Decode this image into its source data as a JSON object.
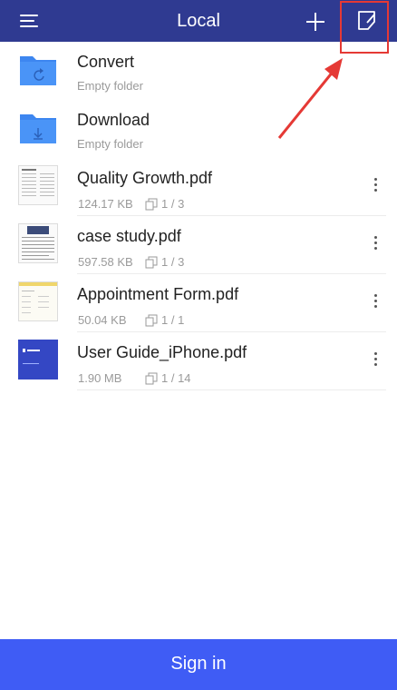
{
  "header": {
    "title": "Local",
    "menu_icon": "hamburger-menu-icon",
    "add_icon": "plus-icon",
    "edit_icon": "edit-note-icon",
    "bar_color": "#2f3a91"
  },
  "annotation": {
    "color": "#e53935"
  },
  "folders": [
    {
      "name": "Convert",
      "subtitle": "Empty folder",
      "icon": "folder-sync-icon"
    },
    {
      "name": "Download",
      "subtitle": "Empty folder",
      "icon": "folder-download-icon"
    }
  ],
  "files": [
    {
      "name": "Quality Growth.pdf",
      "size": "124.17 KB",
      "pages": "1 / 3"
    },
    {
      "name": "case study.pdf",
      "size": "597.58 KB",
      "pages": "1 / 3"
    },
    {
      "name": "Appointment Form.pdf",
      "size": "50.04 KB",
      "pages": "1 / 1"
    },
    {
      "name": "User Guide_iPhone.pdf",
      "size": "1.90 MB",
      "pages": "1 / 14"
    }
  ],
  "footer": {
    "signin_label": "Sign in",
    "color": "#3f5cf5"
  }
}
